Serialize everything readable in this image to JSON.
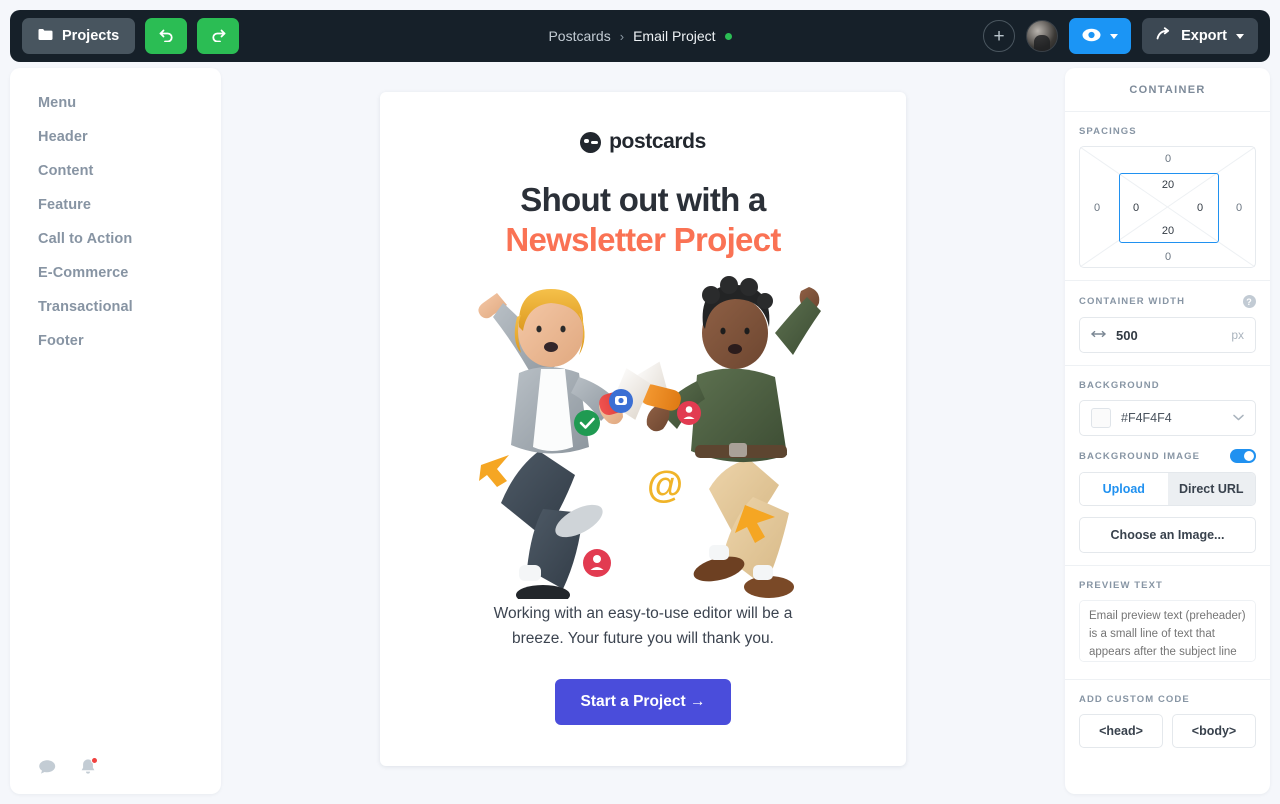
{
  "topbar": {
    "projects_label": "Projects",
    "undo_icon": "undo-arrow-icon",
    "redo_icon": "redo-arrow-icon",
    "breadcrumb": {
      "parent": "Postcards",
      "separator": "›",
      "current": "Email Project"
    },
    "plus_label": "+",
    "preview_icon": "eye-icon",
    "export_label": "Export"
  },
  "sidebar": {
    "items": [
      {
        "label": "Menu"
      },
      {
        "label": "Header"
      },
      {
        "label": "Content"
      },
      {
        "label": "Feature"
      },
      {
        "label": "Call to Action"
      },
      {
        "label": "E-Commerce"
      },
      {
        "label": "Transactional"
      },
      {
        "label": "Footer"
      }
    ],
    "footer": {
      "chat_icon": "chat-bubble-icon",
      "bell_icon": "bell-icon"
    }
  },
  "email": {
    "logo_text": "postcards",
    "headline_line1": "Shout out with a",
    "headline_line2": "Newsletter Project",
    "accent_color": "#FA7254",
    "body_text": "Working with an easy-to-use editor will be a breeze. Your future you will thank you.",
    "cta_label": "Start a Project →",
    "cta_color": "#4A4DDB"
  },
  "right_panel": {
    "title": "CONTAINER",
    "spacings": {
      "label": "SPACINGS",
      "margin_top": "0",
      "margin_right": "0",
      "margin_bottom": "0",
      "margin_left": "0",
      "padding_top": "20",
      "padding_right": "0",
      "padding_bottom": "20",
      "padding_left": "0"
    },
    "container_width": {
      "label": "CONTAINER WIDTH",
      "value": "500",
      "unit": "px",
      "help": "?"
    },
    "background": {
      "label": "BACKGROUND",
      "hex": "#F4F4F4"
    },
    "background_image": {
      "label": "BACKGROUND IMAGE",
      "enabled": true,
      "tab_upload": "Upload",
      "tab_direct_url": "Direct URL",
      "choose_label": "Choose an Image..."
    },
    "preview_text": {
      "label": "PREVIEW TEXT",
      "placeholder": "Email preview text (preheader) is a small line of text that appears after the subject line in the inbox.",
      "value": ""
    },
    "custom_code": {
      "label": "ADD CUSTOM CODE",
      "head_label": "<head>",
      "body_label": "<body>"
    }
  }
}
